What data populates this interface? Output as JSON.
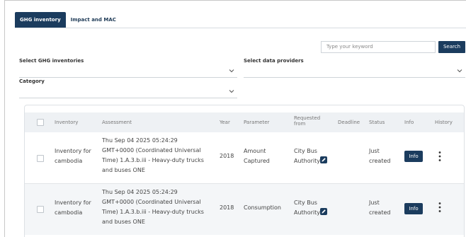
{
  "tabs": [
    {
      "label": "GHG inventory",
      "active": true
    },
    {
      "label": "Impact and MAC",
      "active": false
    }
  ],
  "search": {
    "placeholder": "Type your keyword",
    "button_label": "Search"
  },
  "filters": {
    "ghg_inventories_label": "Select GHG inventories",
    "data_providers_label": "Select data providers",
    "category_label": "Category"
  },
  "table": {
    "headers": {
      "inventory": "Inventory",
      "assessment": "Assessment",
      "year": "Year",
      "parameter": "Parameter",
      "requested_from_1": "Requested",
      "requested_from_2": "from",
      "deadline": "Deadline",
      "status": "Status",
      "info": "Info",
      "history": "History"
    },
    "rows": [
      {
        "inventory_1": "Inventory for",
        "inventory_2": "cambodia",
        "assessment_1": "Thu Sep 04 2025 05:24:29",
        "assessment_2": "GMT+0000 (Coordinated Universal",
        "assessment_3": "Time) 1.A.3.b.iii - Heavy-duty trucks",
        "assessment_4": "and buses ONE",
        "year": "2018",
        "parameter_1": "Amount",
        "parameter_2": "Captured",
        "requested_1": "City Bus",
        "requested_2": "Authority",
        "deadline": "",
        "status_1": "Just",
        "status_2": "created",
        "info_label": "Info"
      },
      {
        "inventory_1": "Inventory for",
        "inventory_2": "cambodia",
        "assessment_1": "Thu Sep 04 2025 05:24:29",
        "assessment_2": "GMT+0000 (Coordinated Universal",
        "assessment_3": "Time) 1.A.3.b.iii - Heavy-duty trucks",
        "assessment_4": "and buses ONE",
        "year": "2018",
        "parameter_1": "Consumption",
        "parameter_2": "",
        "requested_1": "City Bus",
        "requested_2": "Authority",
        "deadline": "",
        "status_1": "Just",
        "status_2": "created",
        "info_label": "Info"
      }
    ]
  },
  "colors": {
    "primary": "#1b3c5e",
    "header_bg": "#eef1f4",
    "row_alt": "#f4f6f8"
  }
}
